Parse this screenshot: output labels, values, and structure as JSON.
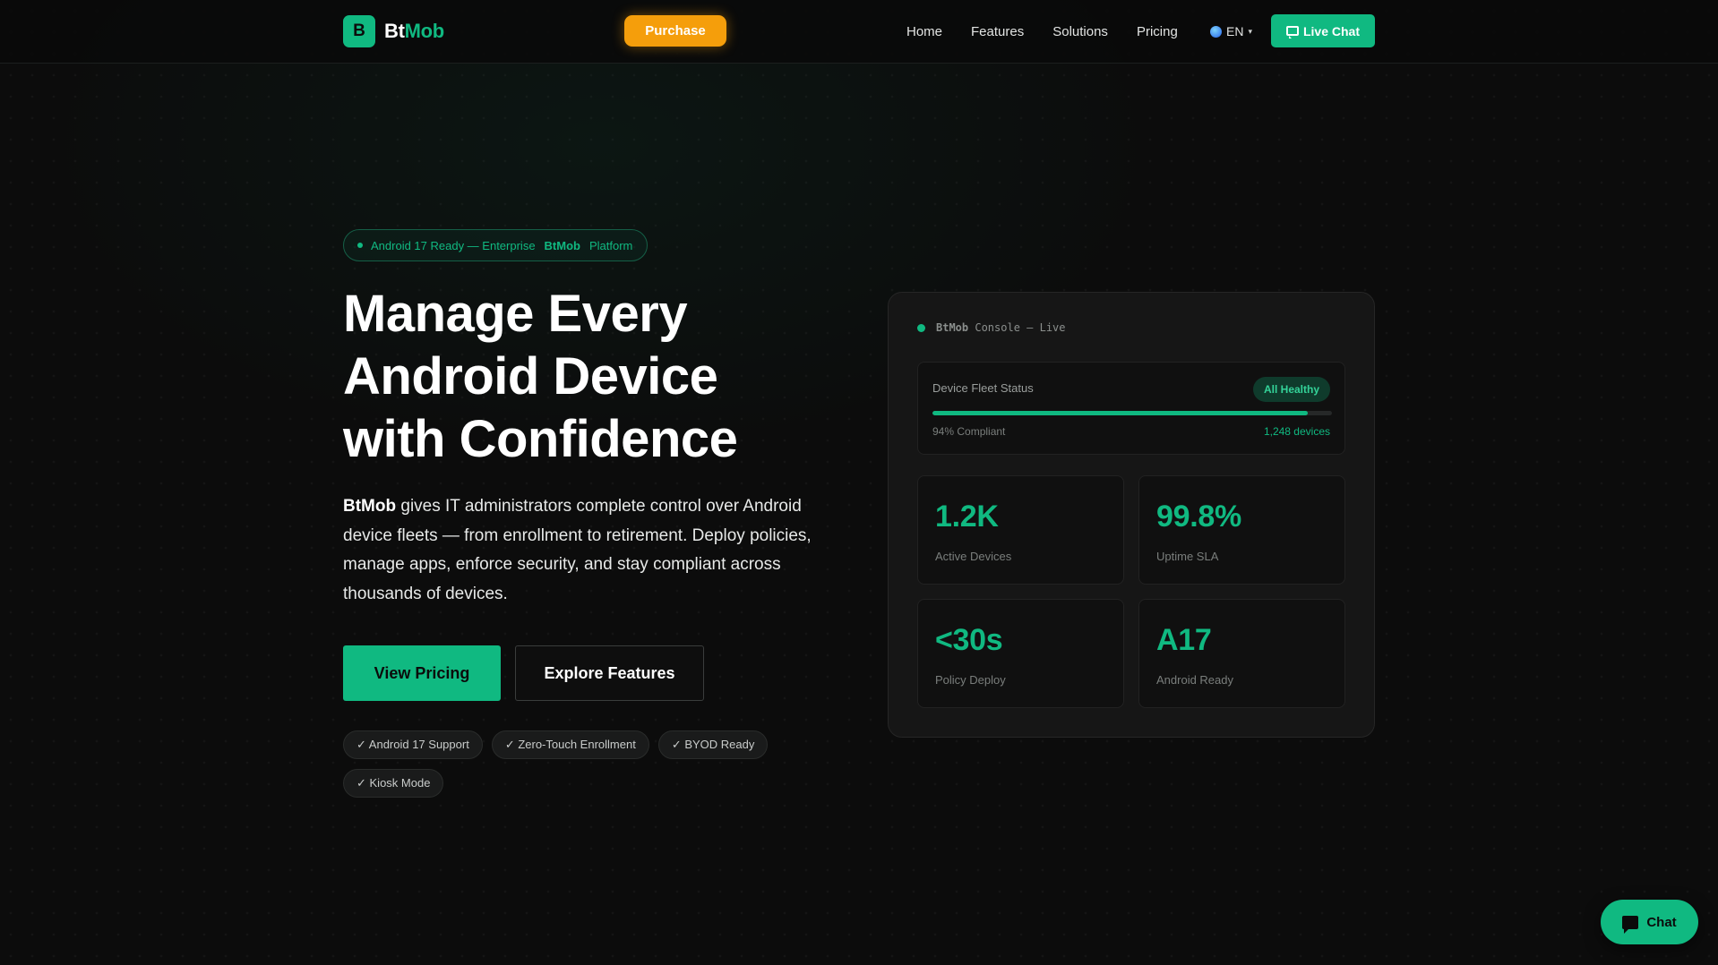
{
  "brand": {
    "logo_letter": "B",
    "name_part1": "Bt",
    "name_part2": "Mob"
  },
  "nav": {
    "purchase_label": "Purchase",
    "links": [
      "Home",
      "Features",
      "Solutions",
      "Pricing"
    ],
    "language": "EN",
    "live_chat_label": "Live Chat"
  },
  "hero": {
    "announcement": {
      "text_before": "Android 17 Ready — Enterprise",
      "brand": "BtMob",
      "text_after": "Platform"
    },
    "title_lines": [
      "Manage Every",
      "Android Device",
      "with Confidence"
    ],
    "description_brand": "BtMob",
    "description_rest": " gives IT administrators complete control over Android device fleets — from enrollment to retirement. Deploy policies, manage apps, enforce security, and stay compliant across thousands of devices.",
    "primary_cta": "View Pricing",
    "secondary_cta": "Explore Features",
    "tags": [
      "✓ Android 17 Support",
      "✓ Zero-Touch Enrollment",
      "✓ BYOD Ready",
      "✓ Kiosk Mode"
    ]
  },
  "console": {
    "header_brand": "BtMob",
    "header_rest": "Console — Live",
    "fleet": {
      "title": "Device Fleet Status",
      "badge": "All Healthy",
      "compliance_label": "94% Compliant",
      "compliance_fraction": 0.94,
      "devices_label": "1,248 devices"
    },
    "stats": [
      {
        "value": "1.2K",
        "label": "Active Devices"
      },
      {
        "value": "99.8%",
        "label": "Uptime SLA"
      },
      {
        "value": "<30s",
        "label": "Policy Deploy"
      },
      {
        "value": "A17",
        "label": "Android Ready"
      }
    ]
  },
  "chat_widget": {
    "label": "Chat"
  },
  "colors": {
    "accent": "#10b981",
    "purchase": "#f59e0b",
    "background": "#0c0c0c",
    "card": "#161616"
  },
  "icons": {
    "logo": "logo-badge-icon",
    "globe": "globe-icon",
    "language_caret": "caret-down-icon",
    "live_chat": "chat-bubble-icon",
    "chat_widget": "chat-bubble-icon",
    "status_dot": "status-dot-icon"
  }
}
